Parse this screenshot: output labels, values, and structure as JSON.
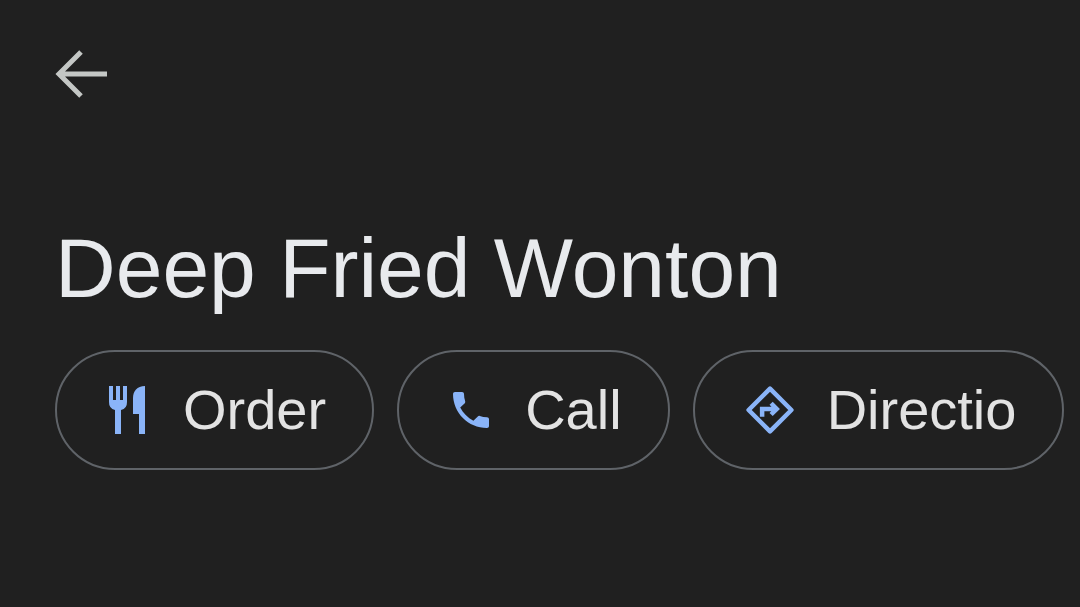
{
  "title": "Deep Fried Wonton",
  "actions": [
    {
      "kind": "order",
      "label": "Order"
    },
    {
      "kind": "call",
      "label": "Call"
    },
    {
      "kind": "directions",
      "label": "Directio"
    }
  ]
}
